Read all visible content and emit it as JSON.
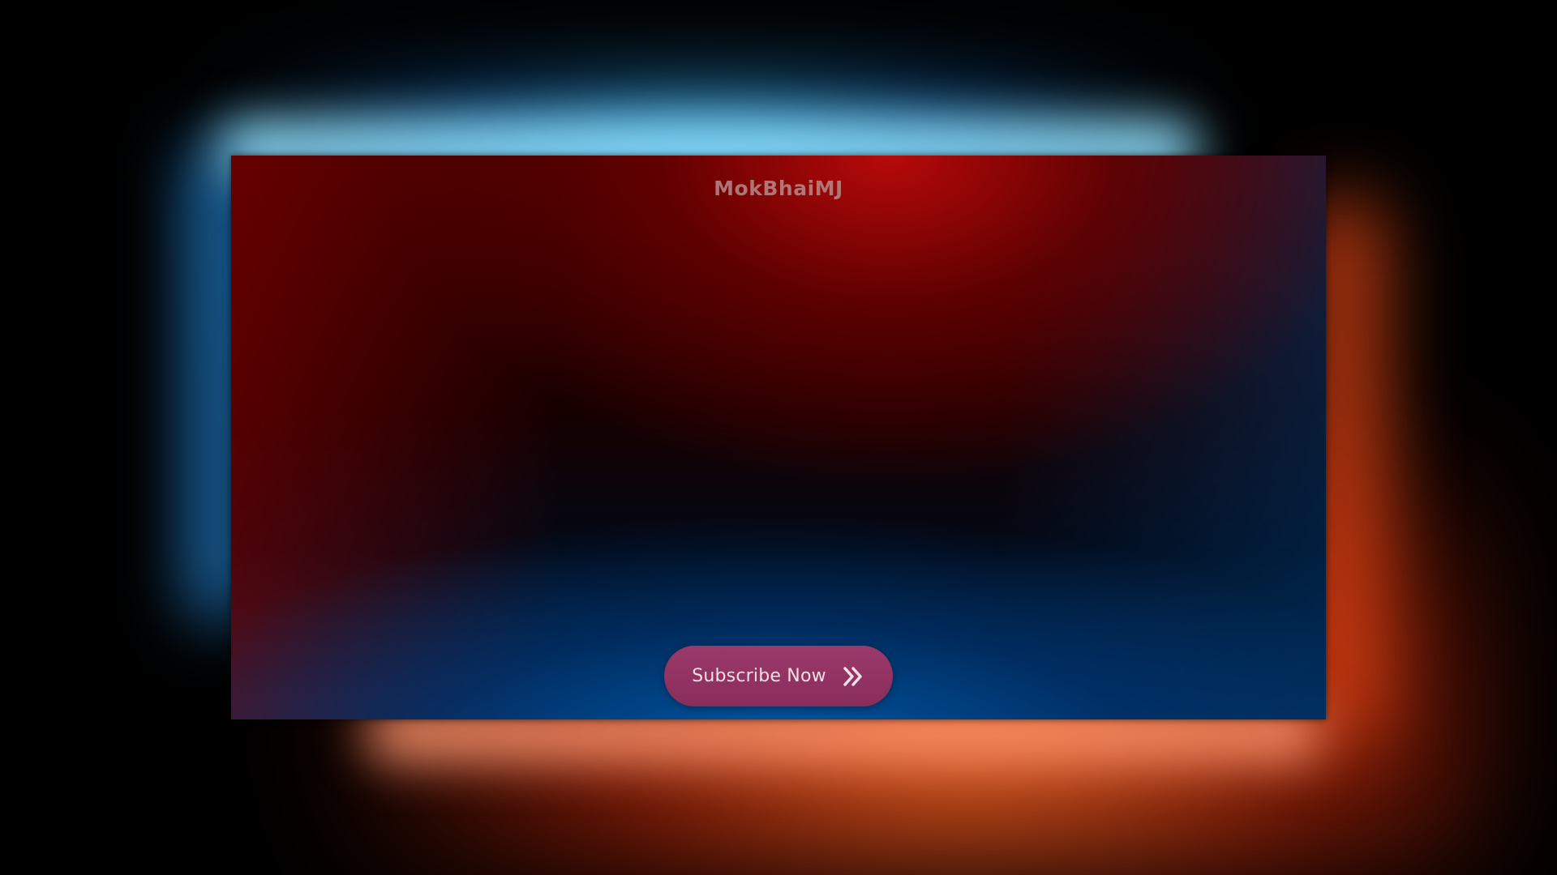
{
  "card": {
    "title": "MokBhaiMJ"
  },
  "subscribe": {
    "label": "Subscribe Now",
    "icon": "double-chevron-right-icon"
  },
  "colors": {
    "background": "#000000",
    "glow_blue": "#3cbeff",
    "glow_orange": "#ff6e28",
    "card_red": "#be0a0a",
    "card_blue": "#005aaa",
    "button": "#8f3263",
    "button_text": "#f1dfe7",
    "title_text": "#b88a8a"
  }
}
